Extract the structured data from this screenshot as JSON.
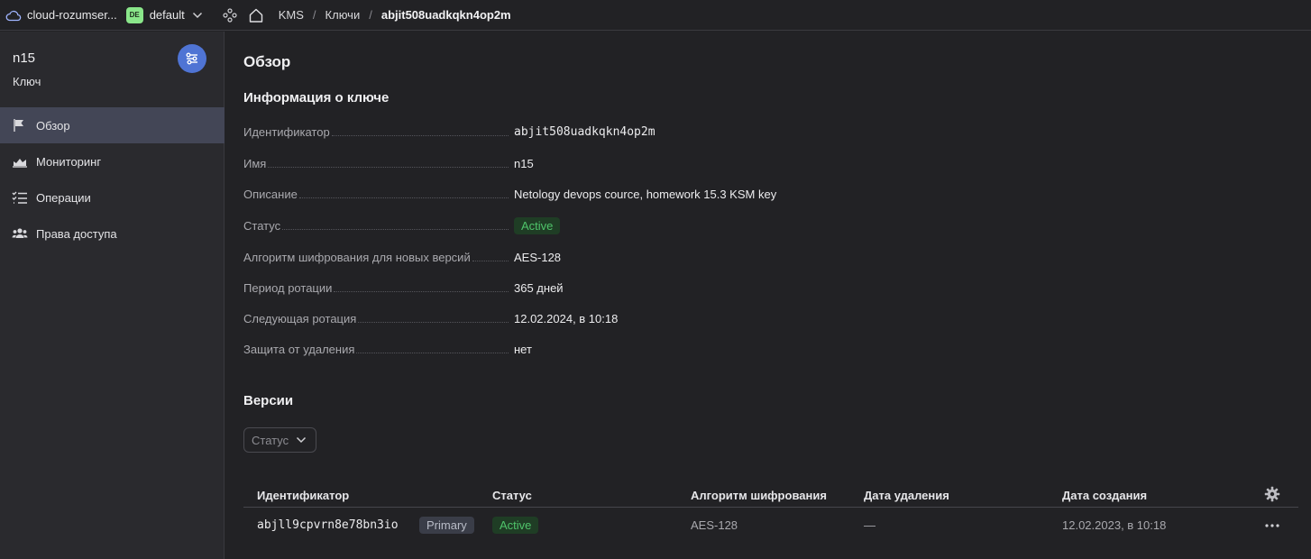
{
  "topbar": {
    "cloud_name": "cloud-rozumser...",
    "folder_badge": "DE",
    "folder_name": "default",
    "breadcrumbs": [
      "KMS",
      "Ключи",
      "abjit508uadkqkn4op2m"
    ],
    "separator": "/"
  },
  "sidebar": {
    "resource_name": "n15",
    "resource_type": "Ключ",
    "items": [
      {
        "label": "Обзор",
        "icon": "flag-icon",
        "active": true
      },
      {
        "label": "Мониторинг",
        "icon": "chart-icon",
        "active": false
      },
      {
        "label": "Операции",
        "icon": "checklist-icon",
        "active": false
      },
      {
        "label": "Права доступа",
        "icon": "users-icon",
        "active": false
      }
    ]
  },
  "main": {
    "page_title": "Обзор",
    "info_title": "Информация о ключе",
    "props": [
      {
        "label": "Идентификатор",
        "value": "abjit508uadkqkn4op2m"
      },
      {
        "label": "Имя",
        "value": "n15"
      },
      {
        "label": "Описание",
        "value": "Netology devops cource, homework 15.3 KSM key"
      },
      {
        "label": "Статус",
        "value": "Active"
      },
      {
        "label": "Алгоритм шифрования для новых версий",
        "value": "AES-128"
      },
      {
        "label": "Период ротации",
        "value": "365 дней"
      },
      {
        "label": "Следующая ротация",
        "value": "12.02.2024, в 10:18"
      },
      {
        "label": "Защита от удаления",
        "value": "нет"
      }
    ],
    "versions_title": "Версии",
    "filter_label": "Статус",
    "table": {
      "columns": [
        "Идентификатор",
        "Статус",
        "Алгоритм шифрования",
        "Дата удаления",
        "Дата создания"
      ],
      "rows": [
        {
          "id": "abjll9cpvrn8e78bn3io",
          "tag": "Primary",
          "status": "Active",
          "algorithm": "AES-128",
          "deleted": "—",
          "created": "12.02.2023, в 10:18"
        }
      ]
    }
  },
  "colors": {
    "accent": "#4f74d4",
    "active_green": "#4fc46a",
    "folder_badge": "#8ae68a"
  }
}
